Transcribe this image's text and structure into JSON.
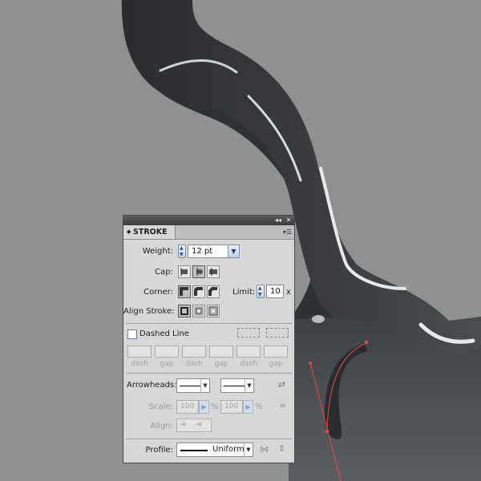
{
  "panel": {
    "title": "STROKE",
    "collapse_icon": "double-left-arrow-icon",
    "close_icon": "close-icon",
    "menu_icon": "panel-menu-icon"
  },
  "weight": {
    "label": "Weight:",
    "value": "12 pt"
  },
  "cap": {
    "label": "Cap:",
    "options": [
      "butt-cap-icon",
      "round-cap-icon",
      "projecting-cap-icon"
    ],
    "selected": 1
  },
  "corner": {
    "label": "Corner:",
    "options": [
      "miter-join-icon",
      "round-join-icon",
      "bevel-join-icon"
    ],
    "selected": 0
  },
  "limit": {
    "label": "Limit:",
    "value": "10",
    "unit": "x"
  },
  "align_stroke": {
    "label": "Align Stroke:",
    "options": [
      "align-center-icon",
      "align-inside-icon",
      "align-outside-icon"
    ],
    "selected": 0
  },
  "dashed_line": {
    "label": "Dashed Line",
    "checked": false
  },
  "dash_fields": [
    {
      "label": "dash"
    },
    {
      "label": "gap"
    },
    {
      "label": "dash"
    },
    {
      "label": "gap"
    },
    {
      "label": "dash"
    },
    {
      "label": "gap"
    }
  ],
  "arrowheads": {
    "label": "Arrowheads:",
    "swap_icon": "swap-arrows-icon"
  },
  "scale": {
    "label": "Scale:",
    "start": "100",
    "end": "100",
    "unit": "%",
    "link_icon": "link-icon"
  },
  "align": {
    "label": "Align:"
  },
  "profile": {
    "label": "Profile:",
    "value": "Uniform",
    "flip_icons": [
      "flip-horizontal-icon",
      "flip-vertical-icon"
    ]
  }
}
